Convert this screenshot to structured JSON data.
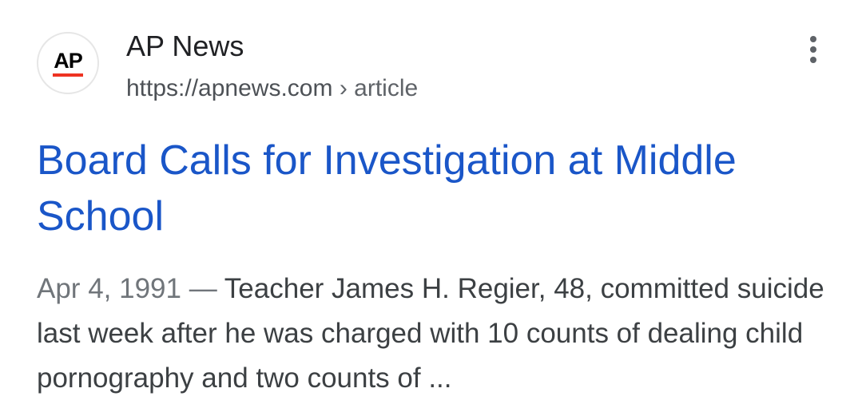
{
  "result": {
    "source": {
      "logo_text": "AP",
      "site_name": "AP News",
      "url": "https://apnews.com",
      "breadcrumb_separator": "›",
      "breadcrumb": "article"
    },
    "more_icon": "more-vert-icon",
    "title": "Board Calls for Investigation at Middle School",
    "snippet": {
      "date": "Apr 4, 1991",
      "separator": "—",
      "text": "Teacher James H. Regier, 48, committed suicide last week after he was charged with 10 counts of dealing child pornography and two counts of ..."
    }
  },
  "colors": {
    "title_link": "#1a56c8",
    "site_name": "#202124",
    "url": "#4d5156",
    "snippet_text": "#3c4043",
    "snippet_date": "#70757a",
    "logo_accent": "#ee3322"
  }
}
